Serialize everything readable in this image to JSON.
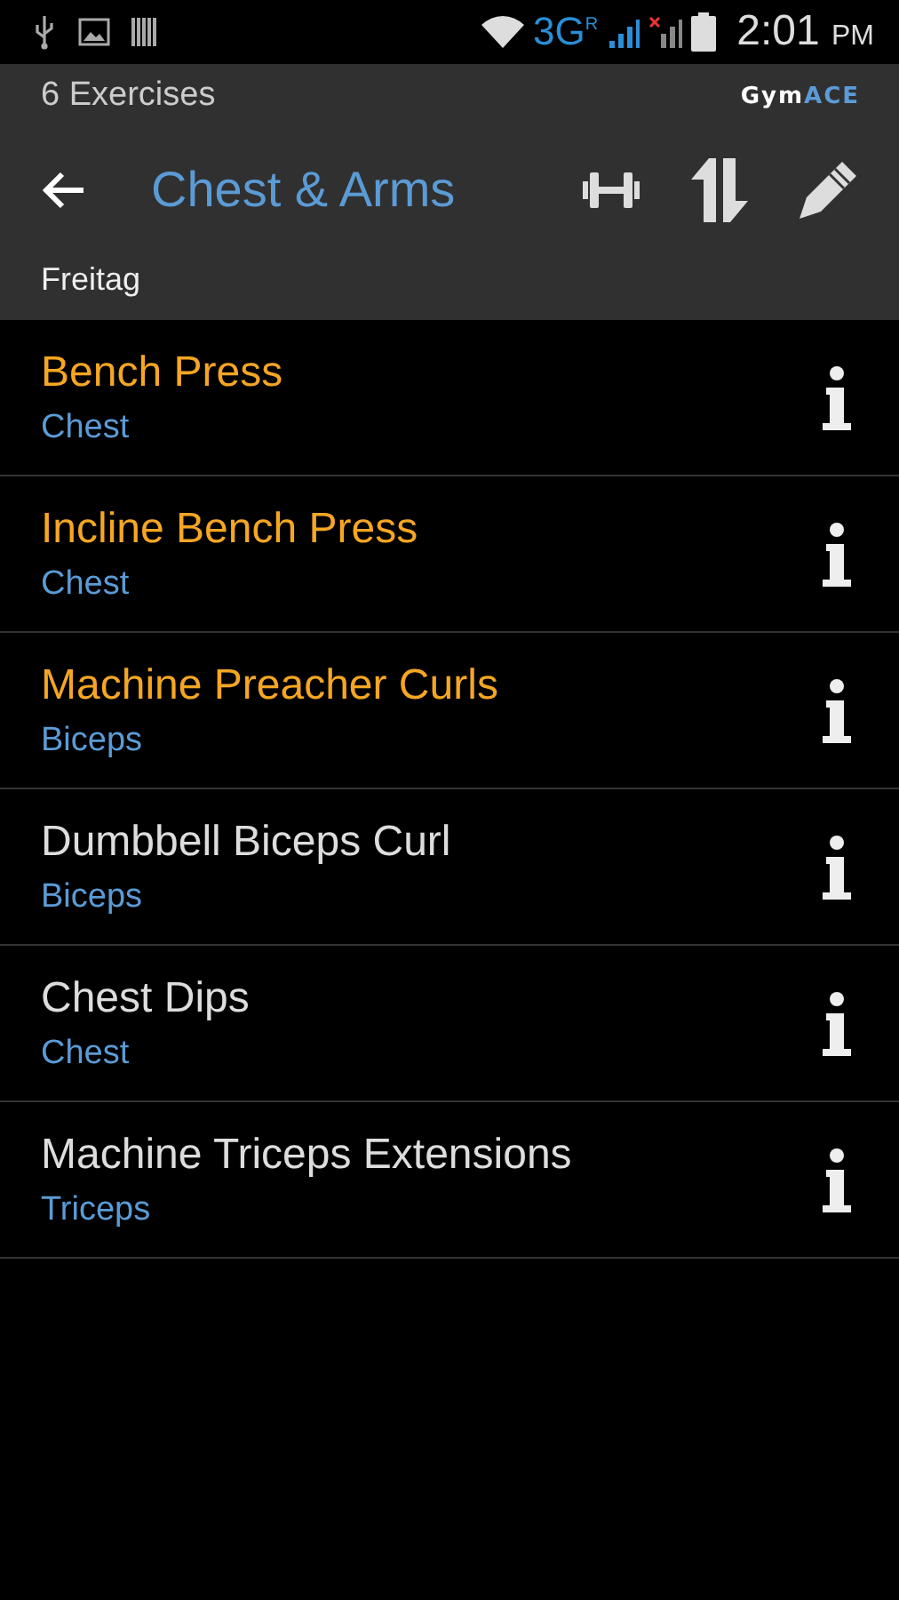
{
  "status_bar": {
    "network": "3G",
    "roaming": "R",
    "time": "2:01",
    "meridiem": "PM"
  },
  "header": {
    "count": "6 Exercises",
    "logo": {
      "first": "Gym",
      "second": "ACE"
    },
    "title": "Chest & Arms",
    "subtitle": "Freitag"
  },
  "exercises": [
    {
      "name": "Bench Press",
      "muscle": "Chest",
      "highlighted": true
    },
    {
      "name": "Incline Bench Press",
      "muscle": "Chest",
      "highlighted": true
    },
    {
      "name": "Machine Preacher Curls",
      "muscle": "Biceps",
      "highlighted": true
    },
    {
      "name": "Dumbbell Biceps Curl",
      "muscle": "Biceps",
      "highlighted": false
    },
    {
      "name": "Chest Dips",
      "muscle": "Chest",
      "highlighted": false
    },
    {
      "name": "Machine Triceps Extensions",
      "muscle": "Triceps",
      "highlighted": false
    }
  ]
}
